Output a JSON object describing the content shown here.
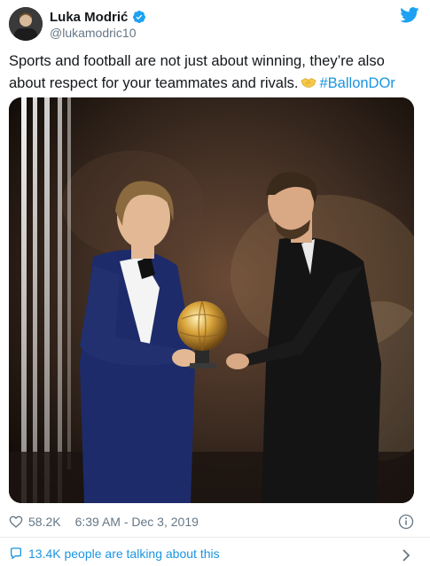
{
  "author": {
    "name": "Luka Modrić",
    "handle": "@lukamodric10",
    "verified": true
  },
  "tweet": {
    "text_before_emoji": "Sports and football are not just about winning, they’re also about respect for your teammates and rivals.",
    "emoji": "handshake-icon",
    "hashtag": "#BallonDOr"
  },
  "stats": {
    "likes": "58.2K",
    "timestamp": "6:39 AM - Dec 3, 2019"
  },
  "conversation": {
    "label": "13.4K people are talking about this"
  },
  "colors": {
    "link": "#1b95e0",
    "muted": "#657786",
    "verified": "#1da1f2"
  }
}
